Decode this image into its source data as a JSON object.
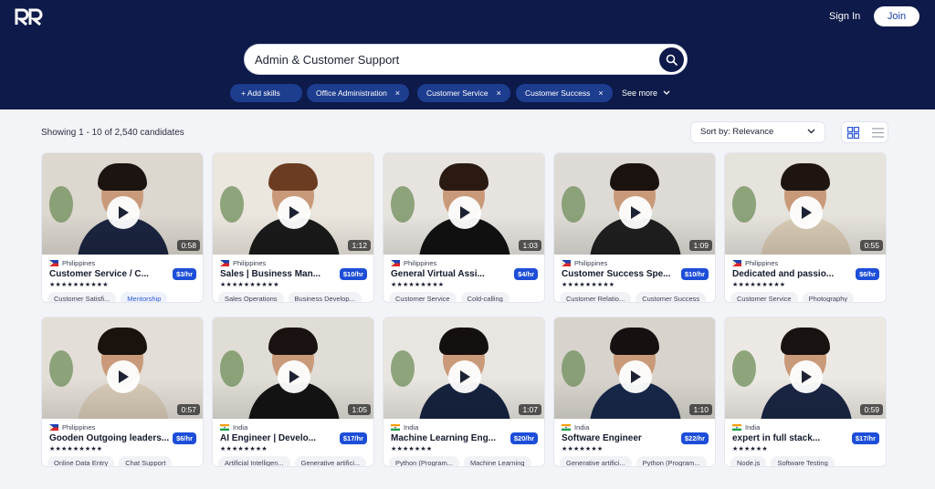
{
  "header": {
    "sign_in": "Sign In",
    "join": "Join"
  },
  "search": {
    "value": "Admin & Customer Support",
    "placeholder": "Search skills"
  },
  "filters": {
    "add_skills": "+ Add skills",
    "chips": [
      "Office Administration",
      "Customer Service",
      "Customer Success"
    ],
    "remove_symbol": "×",
    "see_more": "See more"
  },
  "results": {
    "showing": "Showing 1 - 10 of 2,540 candidates",
    "sort_label": "Sort by: Relevance"
  },
  "colors": {
    "header_bg": "#0d1a4a",
    "chip_bg": "#1d3d8f",
    "rate_badge": "#1d4ed8",
    "page_bg": "#f3f4f7"
  },
  "cards": [
    {
      "country": "Philippines",
      "title": "Customer Service / C...",
      "rate": "$3/hr",
      "duration": "0:58",
      "stars": "★★★★★★★★★★",
      "tags": [
        "Customer Satisfi...",
        "Mentorship"
      ]
    },
    {
      "country": "Philippines",
      "title": "Sales | Business Man...",
      "rate": "$10/hr",
      "duration": "1:12",
      "stars": "★★★★★★★★★★",
      "tags": [
        "Sales Operations",
        "Business Develop..."
      ]
    },
    {
      "country": "Philippines",
      "title": "General Virtual Assi...",
      "rate": "$4/hr",
      "duration": "1:03",
      "stars": "★★★★★★★★★",
      "tags": [
        "Customer Service",
        "Cold-calling"
      ]
    },
    {
      "country": "Philippines",
      "title": "Customer Success Spe...",
      "rate": "$10/hr",
      "duration": "1:09",
      "stars": "★★★★★★★★★",
      "tags": [
        "Customer Relatio...",
        "Customer Success"
      ]
    },
    {
      "country": "Philippines",
      "title": "Dedicated and passio...",
      "rate": "$6/hr",
      "duration": "0:55",
      "stars": "★★★★★★★★★",
      "tags": [
        "Customer Service",
        "Photography"
      ]
    },
    {
      "country": "Philippines",
      "title": "Gooden Outgoing leaders...",
      "rate": "$6/hr",
      "duration": "0:57",
      "stars": "★★★★★★★★★",
      "tags": [
        "Online Data Entry",
        "Chat Support"
      ]
    },
    {
      "country": "India",
      "title": "AI Engineer | Develo...",
      "rate": "$17/hr",
      "duration": "1:05",
      "stars": "★★★★★★★★",
      "tags": [
        "Artificial Intelligen...",
        "Generative artifici..."
      ]
    },
    {
      "country": "India",
      "title": "Machine Learning Eng...",
      "rate": "$20/hr",
      "duration": "1:07",
      "stars": "★★★★★★★",
      "tags": [
        "Python (Program...",
        "Machine Learning"
      ]
    },
    {
      "country": "India",
      "title": "Software Engineer",
      "rate": "$22/hr",
      "duration": "1:10",
      "stars": "★★★★★★★",
      "tags": [
        "Generative artifici...",
        "Python (Program..."
      ]
    },
    {
      "country": "India",
      "title": "expert in full stack...",
      "rate": "$17/hr",
      "duration": "0:59",
      "stars": "★★★★★★",
      "tags": [
        "Node.js",
        "Software Testing"
      ]
    }
  ]
}
